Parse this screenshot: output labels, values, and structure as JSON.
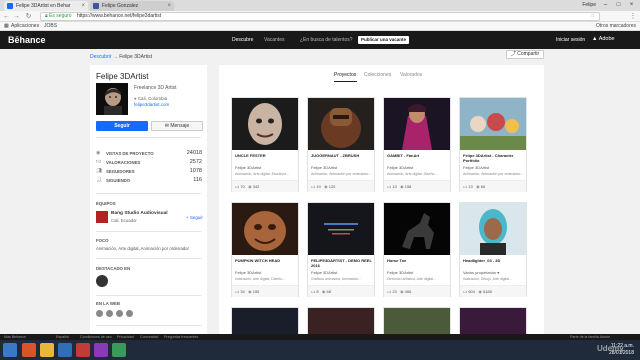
{
  "browser": {
    "tabs": [
      {
        "title": "Felipe 3DArtist en Behar",
        "active": true
      },
      {
        "title": "Felipe Gonzalez",
        "active": false
      }
    ],
    "user_label": "Felipe",
    "url_secure_label": "Es seguro",
    "url": "https://www.behance.net/felipe3dartist",
    "bookmarks": [
      "Aplicaciones",
      "JOBS",
      "Otros marcadores"
    ]
  },
  "behance": {
    "logo": "Bēhance",
    "nav": [
      "Descubre",
      "Vacantes",
      "¿En busca de talentos?"
    ],
    "post_job": "Publicar una vacante",
    "signin": "Iniciar sesión",
    "adobe": "Adobe",
    "breadcrumb": {
      "parent": "Descubrir",
      "arrow": "→",
      "current": "Felipe 3DArtist"
    },
    "share": "Compartir"
  },
  "profile": {
    "name": "Felipe 3DArtist",
    "occupation": "Freelance 3D Artist",
    "location": "Cali, Colombia",
    "website": "felipe3dartist.com",
    "follow": "Seguir",
    "message": "Mensaje",
    "stats": [
      {
        "label": "VISTAS DE PROYECTO",
        "value": "24018"
      },
      {
        "label": "VALORACIONES",
        "value": "2572"
      },
      {
        "label": "SEGUIDORES",
        "value": "1078"
      },
      {
        "label": "SIGUIENDO",
        "value": "116"
      }
    ],
    "team_title": "EQUIPOS",
    "team_name": "Bang Studio Audiovisual",
    "team_location": "Cali, Ecuador",
    "team_follow": "+ Seguir",
    "focus_title": "FOCO",
    "focus_text": "Animación, Arte digital, Animación por ordenador",
    "featured_title": "DESTACADO EN",
    "web_title": "EN LA WEB",
    "about_title": "ABOUT"
  },
  "projects_tabs": [
    "Proyectos",
    "Colecciones",
    "Valorados"
  ],
  "projects": [
    {
      "title": "UNCLE FESTER",
      "owner": "Felipe 3DArtist",
      "fields": "Animación, Arte digital, Escultura...",
      "likes": "70",
      "views": "342"
    },
    {
      "title": "JUGGERNAUT - ZBRUSH",
      "owner": "Felipe 3DArtist",
      "fields": "Animación, Animación por ordenador...",
      "likes": "19",
      "views": "120"
    },
    {
      "title": "GAMBIT - FanArt",
      "owner": "Felipe 3DArtist",
      "fields": "Animación, Arte digital, Diseño...",
      "likes": "13",
      "views": "158"
    },
    {
      "title": "Felipe 3DArtist - Character Portfolio",
      "owner": "Felipe 3DArtist",
      "fields": "Animación, Animación por ordenador...",
      "likes": "13",
      "views": "66"
    },
    {
      "title": "PUMPKIN WITCH HEAD",
      "owner": "Felipe 3DArtist",
      "fields": "Ilustración, Arte digital, Diseño...",
      "likes": "34",
      "views": "155"
    },
    {
      "title": "FELIPE3DARTIST - DEMO REEL 2016",
      "owner": "Felipe 3DArtist",
      "fields": "Gráficos animados, Animación...",
      "likes": "8",
      "views": "68"
    },
    {
      "title": "Horse Toe",
      "owner": "Felipe 3DArtist",
      "fields": "Dirección artística, Arte digital...",
      "likes": "23",
      "views": "466"
    },
    {
      "title": "Headlighter_03 - 3D",
      "owner": "Varios propietarios",
      "fields": "Ilustración, Dibujo, Arte digital...",
      "likes": "604",
      "views": "5188"
    }
  ],
  "footer": [
    "Más Behance",
    "Español",
    "Condiciones de uso",
    "Privacidad",
    "Comunidad",
    "Preguntas frecuentes"
  ],
  "footer_right": "Parte de la familia Adobe",
  "taskbar": {
    "time": "11:22 a.m.",
    "date": "28/01/2018"
  },
  "watermark": "Udemy"
}
